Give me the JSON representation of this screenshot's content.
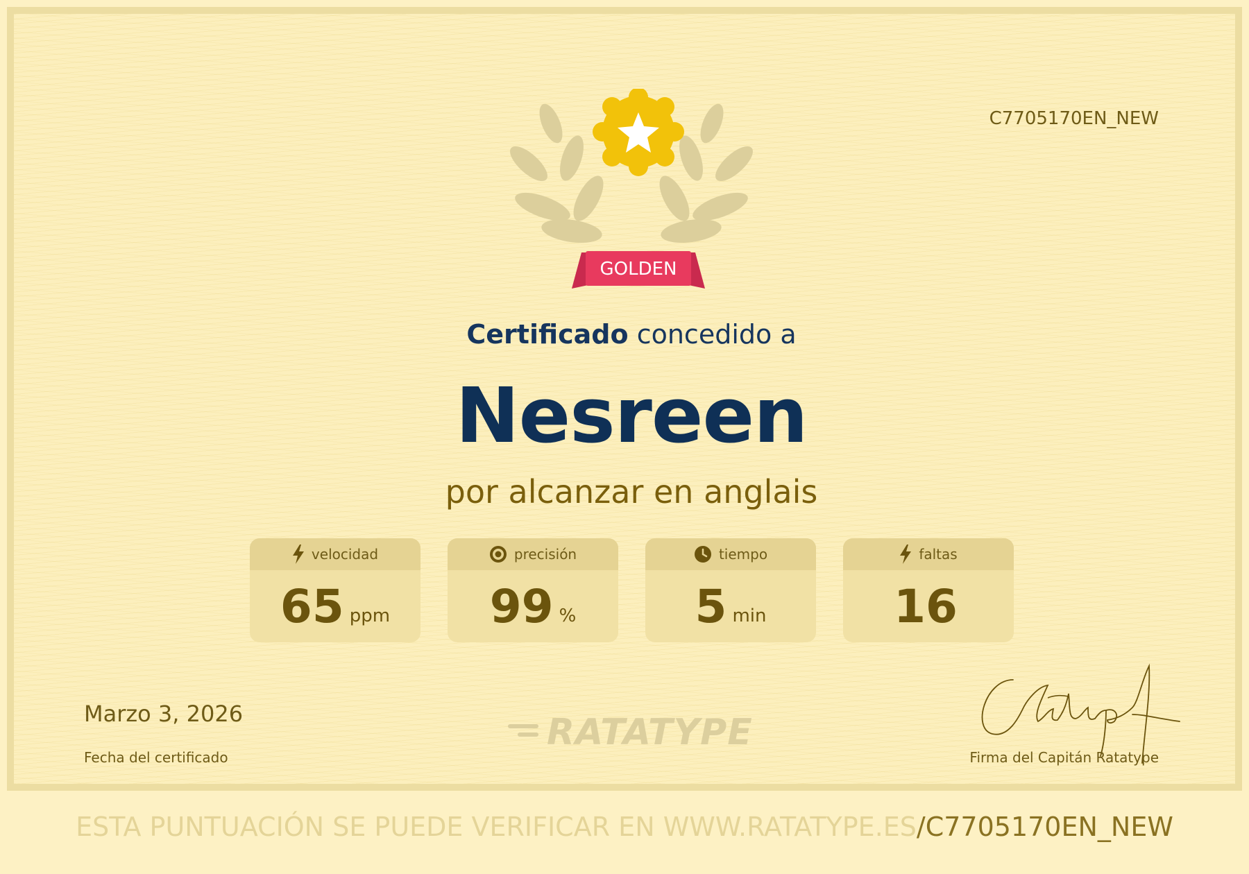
{
  "certificate": {
    "code": "C7705170EN_NEW",
    "badge_label": "GOLDEN",
    "heading_strong": "Certificado",
    "heading_rest": "concedido a",
    "recipient_name": "Nesreen",
    "subtitle": "por alcanzar en anglais",
    "colors": {
      "background": "#fcefbd",
      "name": "#0f3056",
      "accent_gold": "#f2c20a",
      "ribbon_red": "#e83a5e",
      "text_brown": "#6e5b17"
    }
  },
  "stats": [
    {
      "icon": "bolt-icon",
      "label": "velocidad",
      "value": "65",
      "unit": "ppm"
    },
    {
      "icon": "target-icon",
      "label": "precisión",
      "value": "99",
      "unit": "%"
    },
    {
      "icon": "clock-icon",
      "label": "tiempo",
      "value": "5",
      "unit": "min"
    },
    {
      "icon": "bolt-icon",
      "label": "faltas",
      "value": "16",
      "unit": ""
    }
  ],
  "footer": {
    "date": "Marzo 3, 2026",
    "date_label": "Fecha del certificado",
    "brand": "RATATYPE",
    "signature_text": "Ratatype",
    "signature_label": "Firma del Capitán Ratatype"
  },
  "verify": {
    "text": "ESTA PUNTUACIÓN SE PUEDE VERIFICAR EN WWW.RATATYPE.ES",
    "code": "/C7705170EN_NEW"
  }
}
